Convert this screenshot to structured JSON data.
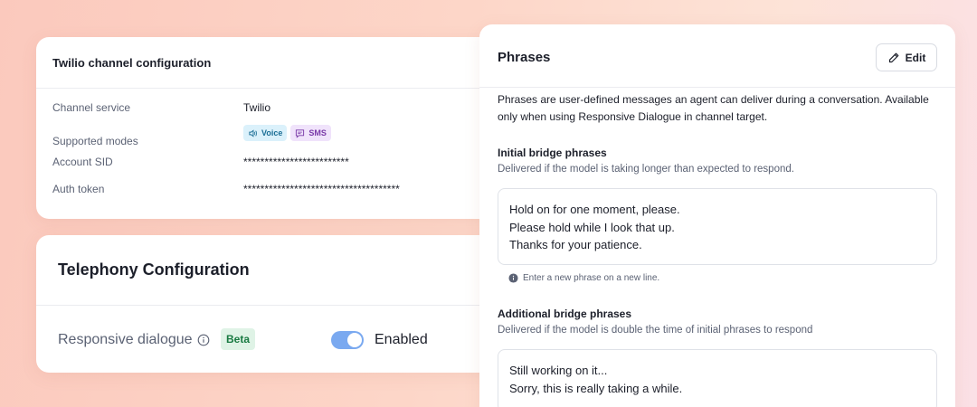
{
  "twilio": {
    "title": "Twilio channel configuration",
    "rows": [
      {
        "key": "Channel service",
        "value": "Twilio"
      },
      {
        "key": "Supported modes",
        "voice": "Voice",
        "sms": "SMS"
      },
      {
        "key": "Account SID",
        "value": "*************************"
      },
      {
        "key": "Auth token",
        "value": "*************************************"
      }
    ]
  },
  "telephony": {
    "title": "Telephony Configuration",
    "responsive_label": "Responsive dialogue",
    "beta": "Beta",
    "toggle_state": "Enabled"
  },
  "phrases": {
    "title": "Phrases",
    "edit_label": "Edit",
    "description": "Phrases are user-defined messages an agent can deliver during a conversation. Available only when using Responsive Dialogue in channel target.",
    "initial": {
      "title": "Initial bridge phrases",
      "subtitle": "Delivered if the model is taking longer than expected to respond.",
      "lines": [
        "Hold on for one moment, please.",
        "Please hold while I look that up.",
        "Thanks for your patience."
      ],
      "hint": "Enter a new phrase on a new line."
    },
    "additional": {
      "title": "Additional bridge phrases",
      "subtitle": "Delivered if the model is double the time of initial phrases to respond",
      "lines": [
        "Still working on it...",
        "Sorry, this is really taking a while."
      ]
    }
  },
  "colors": {
    "toggle_on": "#7aa9f0",
    "beta_bg": "#dff3e6",
    "beta_text": "#197a42",
    "voice_bg": "#dbf1fb",
    "sms_bg": "#f0e3fb"
  }
}
